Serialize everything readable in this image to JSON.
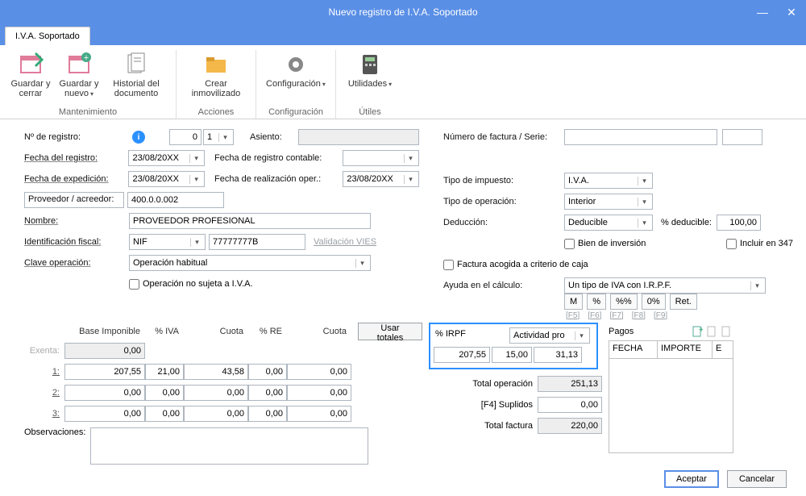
{
  "window": {
    "title": "Nuevo registro de I.V.A. Soportado"
  },
  "tab": {
    "label": "I.V.A. Soportado"
  },
  "ribbon": {
    "guardar_cerrar": "Guardar y cerrar",
    "guardar_nuevo": "Guardar y nuevo",
    "historial": "Historial del documento",
    "mantenimiento": "Mantenimiento",
    "crear_inm": "Crear inmovilizado",
    "acciones": "Acciones",
    "config": "Configuración",
    "config_grp": "Configuración",
    "utilidades": "Utilidades",
    "utiles": "Útiles"
  },
  "left": {
    "n_registro": "Nº de registro:",
    "n_registro_val": "0",
    "n_registro_serie": "1",
    "asiento": "Asiento:",
    "asiento_val": "",
    "fecha_registro": "Fecha del registro:",
    "fecha_registro_val": "23/08/20XX",
    "fecha_reg_cont": "Fecha de registro contable:",
    "fecha_reg_cont_val": "",
    "fecha_exp": "Fecha de expedición:",
    "fecha_exp_val": "23/08/20XX",
    "fecha_real": "Fecha de realización oper.:",
    "fecha_real_val": "23/08/20XX",
    "proveedor": "Proveedor / acreedor:",
    "proveedor_val": "400.0.0.002",
    "nombre": "Nombre:",
    "nombre_val": "PROVEEDOR PROFESIONAL",
    "ident_fiscal": "Identificación fiscal:",
    "ident_tipo": "NIF",
    "ident_val": "77777777B",
    "validacion": "Validación VIES",
    "clave_op": "Clave operación:",
    "clave_op_val": "Operación habitual",
    "op_no_sujeta": "Operación no sujeta a I.V.A."
  },
  "right": {
    "num_factura": "Número de factura / Serie:",
    "num_factura_val": "",
    "serie_val": "",
    "tipo_imp": "Tipo de impuesto:",
    "tipo_imp_val": "I.V.A.",
    "tipo_op": "Tipo de operación:",
    "tipo_op_val": "Interior",
    "deduccion": "Deducción:",
    "deduccion_val": "Deducible",
    "pct_deducible": "% deducible:",
    "pct_deducible_val": "100,00",
    "bien_inv": "Bien de inversión",
    "incluir_347": "Incluir en 347",
    "criterio_caja": "Factura acogida a criterio de caja",
    "ayuda_calc": "Ayuda en el cálculo:",
    "ayuda_calc_val": "Un tipo de IVA con I.R.P.F.",
    "btn_M": "M",
    "btn_pct": "%",
    "btn_pctpct": "%%",
    "btn_0pct": "0%",
    "btn_ret": "Ret.",
    "f5": "[F5]",
    "f6": "[F6]",
    "f7": "[F7]",
    "f8": "[F8]",
    "f9": "[F9]"
  },
  "grid": {
    "base": "Base Imponible",
    "pct_iva": "% IVA",
    "cuota": "Cuota",
    "pct_re": "% RE",
    "cuota2": "Cuota",
    "usar_totales": "Usar totales",
    "exenta": "Exenta:",
    "r1": "1:",
    "r2": "2:",
    "r3": "3:",
    "e_base": "0,00",
    "v": [
      {
        "base": "207,55",
        "iva": "21,00",
        "cuota": "43,58",
        "re": "0,00",
        "cuota2": "0,00"
      },
      {
        "base": "0,00",
        "iva": "0,00",
        "cuota": "0,00",
        "re": "0,00",
        "cuota2": "0,00"
      },
      {
        "base": "0,00",
        "iva": "0,00",
        "cuota": "0,00",
        "re": "0,00",
        "cuota2": "0,00"
      }
    ]
  },
  "irpf": {
    "pct_irpf": "% IRPF",
    "actividad": "Actividad pro",
    "base": "207,55",
    "pct": "15,00",
    "cuota": "31,13"
  },
  "totals": {
    "total_op": "Total operación",
    "total_op_v": "251,13",
    "suplidos": "[F4] Suplidos",
    "suplidos_v": "0,00",
    "total_fact": "Total factura",
    "total_fact_v": "220,00"
  },
  "pagos": {
    "title": "Pagos",
    "fecha": "FECHA",
    "importe": "IMPORTE",
    "e": "E"
  },
  "obs": "Observaciones:",
  "btns": {
    "aceptar": "Aceptar",
    "cancelar": "Cancelar"
  }
}
